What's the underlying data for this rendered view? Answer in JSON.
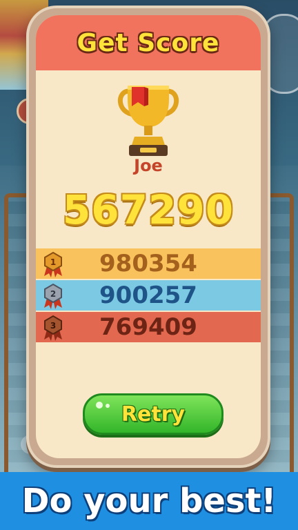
{
  "dialog": {
    "title": "Get Score",
    "player_name": "Joe",
    "score": "567290"
  },
  "leaderboard": [
    {
      "rank": "1",
      "score": "980354",
      "color": "#f9c25c"
    },
    {
      "rank": "2",
      "score": "900257",
      "color": "#7cc9e4"
    },
    {
      "rank": "3",
      "score": "769409",
      "color": "#e2694f"
    }
  ],
  "buttons": {
    "retry_label": "Retry"
  },
  "promo": {
    "banner_text": "Do your best!"
  },
  "icons": [
    "trophy-icon",
    "medal-gold-icon",
    "medal-silver-icon",
    "medal-bronze-icon"
  ]
}
